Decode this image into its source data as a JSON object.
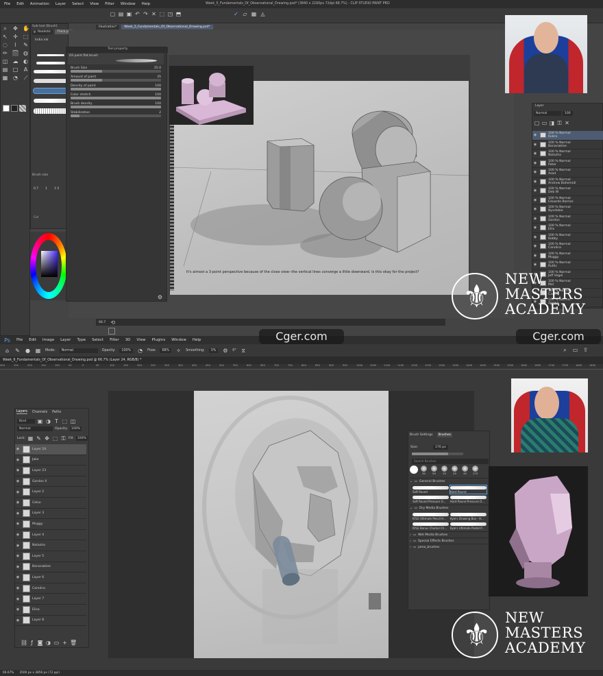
{
  "top_app": {
    "menu": [
      "File",
      "Edit",
      "Animation",
      "Layer",
      "Select",
      "View",
      "Filter",
      "Window",
      "Help"
    ],
    "title": "Week_5_Fundamentals_Of_Observational_Drawing.psd* (3840 x 2160px 72dpi 68.7%) - CLIP STUDIO PAINT PRO",
    "subtool_name": "Sub tool [Brush]",
    "brush_tabs": [
      "Waterco",
      "Realistic",
      "Thick pa"
    ],
    "brush_item": "India ink",
    "doc_tabs": [
      "Illustration*",
      "Week_5_Fundamentals_Of_Observational_Drawing.psd*"
    ],
    "tool_property_title": "Tool property",
    "brush_name": "Oil paint flat brush",
    "properties": [
      {
        "label": "Brush Size",
        "value": "35.0",
        "level": 0.35
      },
      {
        "label": "Amount of paint",
        "value": "35",
        "level": 0.35
      },
      {
        "label": "Density of paint",
        "value": "100",
        "level": 1.0
      },
      {
        "label": "Color stretch",
        "value": "100",
        "level": 1.0
      },
      {
        "label": "Brush density",
        "value": "100",
        "level": 1.0
      },
      {
        "label": "Stabilization",
        "value": "2",
        "level": 0.1
      }
    ],
    "brush_size_panel": "Brush size",
    "size_presets": [
      "0.7",
      "1",
      "1.5"
    ],
    "color_tab": "Col",
    "caption": "It's almost a 3-point perspective because of the close view--the vertical lines converge a little downward. Is this okay for the project?",
    "zoom": "68.7",
    "layer_panel_title": "Layer",
    "blend_mode": "Normal",
    "opacity": "100",
    "layers": [
      {
        "pct": "100 %",
        "mode": "Normal",
        "name": "Kobra"
      },
      {
        "pct": "100 %",
        "mode": "Normal",
        "name": "Bananaklee"
      },
      {
        "pct": "100 %",
        "mode": "Normal",
        "name": "Natasha"
      },
      {
        "pct": "100 %",
        "mode": "Normal",
        "name": "Peter"
      },
      {
        "pct": "100 %",
        "mode": "Normal",
        "name": "Asad"
      },
      {
        "pct": "100 %",
        "mode": "Normal",
        "name": "Andrew Bohemidi"
      },
      {
        "pct": "100 %",
        "mode": "Normal",
        "name": "Deb W"
      },
      {
        "pct": "100 %",
        "mode": "Normal",
        "name": "Eduardo Barrios"
      },
      {
        "pct": "100 %",
        "mode": "Normal",
        "name": "Nyxdebie"
      },
      {
        "pct": "100 %",
        "mode": "Normal",
        "name": "Gordon"
      },
      {
        "pct": "100 %",
        "mode": "Normal",
        "name": "Ellis"
      },
      {
        "pct": "100 %",
        "mode": "Normal",
        "name": "Kobby"
      },
      {
        "pct": "100 %",
        "mode": "Normal",
        "name": "Carolina"
      },
      {
        "pct": "100 %",
        "mode": "Normal",
        "name": "Muggy"
      },
      {
        "pct": "100 %",
        "mode": "Normal",
        "name": "Rutlis"
      },
      {
        "pct": "100 %",
        "mode": "Normal",
        "name": "Jeff Vogel"
      },
      {
        "pct": "100 %",
        "mode": "Normal",
        "name": "Mel"
      },
      {
        "pct": "100 %",
        "mode": "Normal",
        "name": "Cassie"
      },
      {
        "pct": "100 %",
        "mode": "Normal",
        "name": "Zeewa"
      }
    ]
  },
  "bottom_app": {
    "menu": [
      "File",
      "Edit",
      "Image",
      "Layer",
      "Type",
      "Select",
      "Filter",
      "3D",
      "View",
      "Plugins",
      "Window",
      "Help"
    ],
    "doc_tab": "Week_6_Fundamentals_Of_Observational_Drawing.psd @ 66.7% (Layer 24, RGB/8) *",
    "options": {
      "mode_label": "Mode:",
      "mode": "Normal",
      "opacity_label": "Opacity:",
      "opacity": "100%",
      "flow_label": "Flow:",
      "flow": "68%",
      "smoothing_label": "Smoothing:",
      "smoothing": "3%",
      "angle": "0°"
    },
    "ruler": [
      "300",
      "250",
      "200",
      "150",
      "100",
      "50",
      "0",
      "50",
      "100",
      "150",
      "200",
      "250",
      "300",
      "350",
      "400",
      "450",
      "500",
      "550",
      "600",
      "650",
      "700",
      "750",
      "800",
      "850",
      "900",
      "950",
      "1000",
      "1050",
      "1100",
      "1150",
      "1200",
      "1250",
      "1300",
      "1350",
      "1400",
      "1450",
      "1500",
      "1550",
      "1600",
      "1650",
      "1700",
      "1750",
      "1800",
      "1850"
    ],
    "layers_tabs": [
      "Layers",
      "Channels",
      "Paths"
    ],
    "kind": "Kind",
    "blend": "Normal",
    "opacity_label": "Opacity:",
    "opacity": "100%",
    "lock_label": "Lock:",
    "fill_label": "Fill:",
    "fill": "100%",
    "layers": [
      "Layer 24",
      "Jake",
      "Layer 23",
      "Gordan X",
      "Layer 2",
      "Celso",
      "Layer 3",
      "Muggy",
      "Layer 4",
      "Natasha",
      "Layer 5",
      "Bananaklee",
      "Layer 6",
      "Carolina",
      "Layer 7",
      "Elisa",
      "Layer 8"
    ],
    "brushes_tabs": [
      "Brush Settings",
      "Brushes"
    ],
    "size_label": "Size:",
    "size_value": "176 px",
    "search_placeholder": "Search Brushes",
    "preset_sizes": [
      "30",
      "50",
      "25",
      "25",
      "45",
      "175"
    ],
    "groups": [
      {
        "name": "General Brushes",
        "items": [
          "Soft Round",
          "Hard Round",
          "Soft Round Pressure O...",
          "Hard Round Pressure O..."
        ]
      },
      {
        "name": "Dry Media Brushes",
        "items": [
          "KYLE Ultimate Pencil H...",
          "Kyle's Drawing Box - H...",
          "KYLE Bonus Charkol Ch...",
          "Kyle's Ultimate Pastel P..."
        ]
      },
      {
        "name": "Wet Media Brushes",
        "items": []
      },
      {
        "name": "Special Effects Brushes",
        "items": []
      },
      {
        "name": "jama_brushes",
        "items": []
      }
    ],
    "status": "66.67%",
    "status_doc": "3500 px x 3856 px (72 ppi)"
  },
  "watermark": {
    "line1": "NEW",
    "line2": "MASTERS",
    "line3": "ACADEMY"
  },
  "cger": "Cger.com",
  "colors": {
    "accent": "#5aa0e0",
    "canvas_bg": "#2f2f2f",
    "panel": "#3b3b3b",
    "paper": "#c9c9c9",
    "pink_model": "#d9b7d6"
  }
}
